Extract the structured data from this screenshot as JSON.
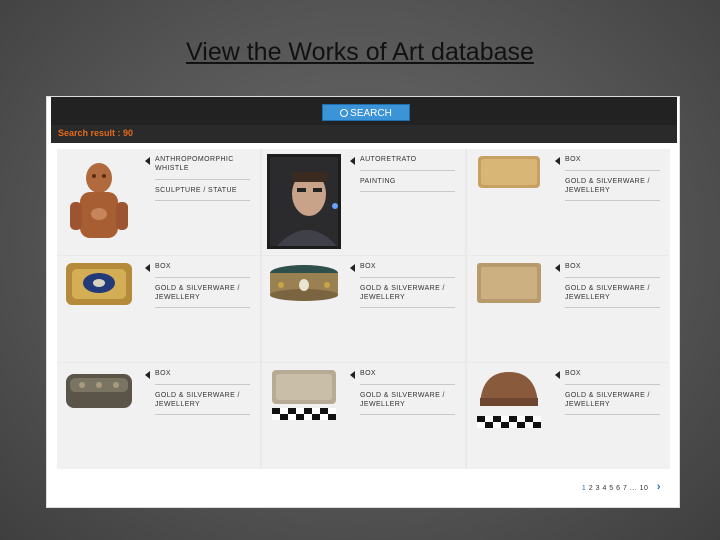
{
  "slide": {
    "title": "View the Works of Art database"
  },
  "header": {
    "search_label": "SEARCH"
  },
  "results": {
    "label": "Search result : 90"
  },
  "items": [
    {
      "title": "ANTHROPOMORPHIC WHISTLE",
      "category": "SCULPTURE / STATUE"
    },
    {
      "title": "AUTORETRATO",
      "category": "PAINTING"
    },
    {
      "title": "BOX",
      "category": "GOLD & SILVERWARE / JEWELLERY"
    },
    {
      "title": "BOX",
      "category": "GOLD & SILVERWARE / JEWELLERY"
    },
    {
      "title": "BOX",
      "category": "GOLD & SILVERWARE / JEWELLERY"
    },
    {
      "title": "BOX",
      "category": "GOLD & SILVERWARE / JEWELLERY"
    },
    {
      "title": "BOX",
      "category": "GOLD & SILVERWARE / JEWELLERY"
    },
    {
      "title": "BOX",
      "category": "GOLD & SILVERWARE / JEWELLERY"
    },
    {
      "title": "BOX",
      "category": "GOLD & SILVERWARE / JEWELLERY"
    }
  ],
  "pagination": {
    "first": "1",
    "rest": "2 3 4 5 6 7 ... 10"
  }
}
